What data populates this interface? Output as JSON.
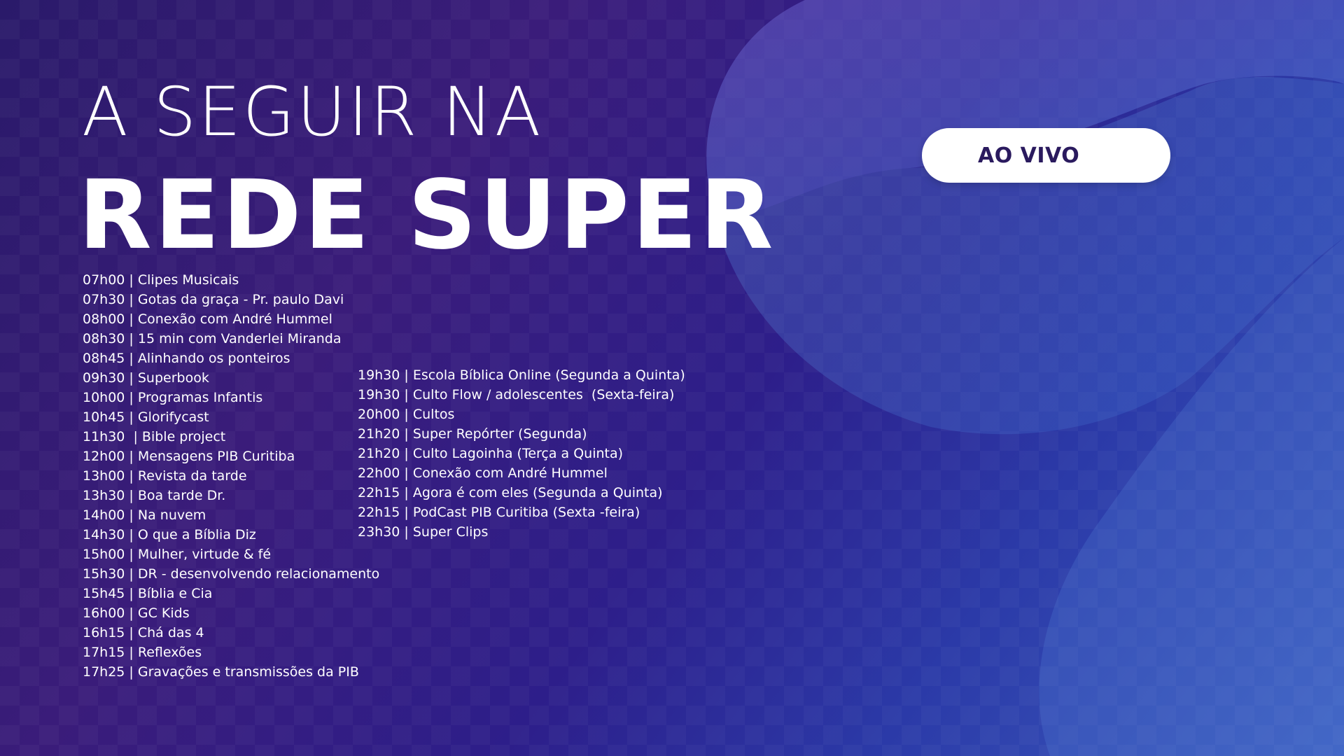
{
  "title": {
    "line1": "A SEGUIR NA",
    "line2": "REDE SUPER"
  },
  "live_button": {
    "label": "AO VIVO"
  },
  "schedule": {
    "left": [
      "07h00 | Clipes Musicais",
      "07h30 | Gotas da graça - Pr. paulo Davi",
      "08h00 | Conexão com André Hummel",
      "08h30 | 15 min com Vanderlei Miranda",
      "08h45 | Alinhando os ponteiros",
      "09h30 | Superbook",
      "10h00 | Programas Infantis",
      "10h45 | Glorifycast",
      "11h30  | Bible project",
      "12h00 | Mensagens PIB Curitiba",
      "13h00 | Revista da tarde",
      "13h30 | Boa tarde Dr.",
      "14h00 | Na nuvem",
      "14h30 | O que a Bíblia Diz",
      "15h00 | Mulher, virtude & fé",
      "15h30 | DR - desenvolvendo relacionamento",
      "15h45 | Bíblia e Cia",
      "16h00 | GC Kids",
      "16h15 | Chá das 4",
      "17h15 | Reflexões",
      "17h25 | Gravações e transmissões da PIB"
    ],
    "right": [
      "19h30 | Escola Bíblica Online (Segunda a Quinta)",
      "19h30 | Culto Flow / adolescentes  (Sexta-feira)",
      "20h00 | Cultos",
      "21h20 | Super Repórter (Segunda)",
      "21h20 | Culto Lagoinha (Terça a Quinta)",
      "22h00 | Conexão com André Hummel",
      "22h15 | Agora é com eles (Segunda a Quinta)",
      "22h15 | PodCast PIB Curitiba (Sexta -feira)",
      "23h30 | Super Clips"
    ]
  },
  "colors": {
    "background_start": "#2a1a6a",
    "background_end": "#3d5ec0",
    "button_text": "#2a1a5e",
    "text": "#ffffff"
  }
}
